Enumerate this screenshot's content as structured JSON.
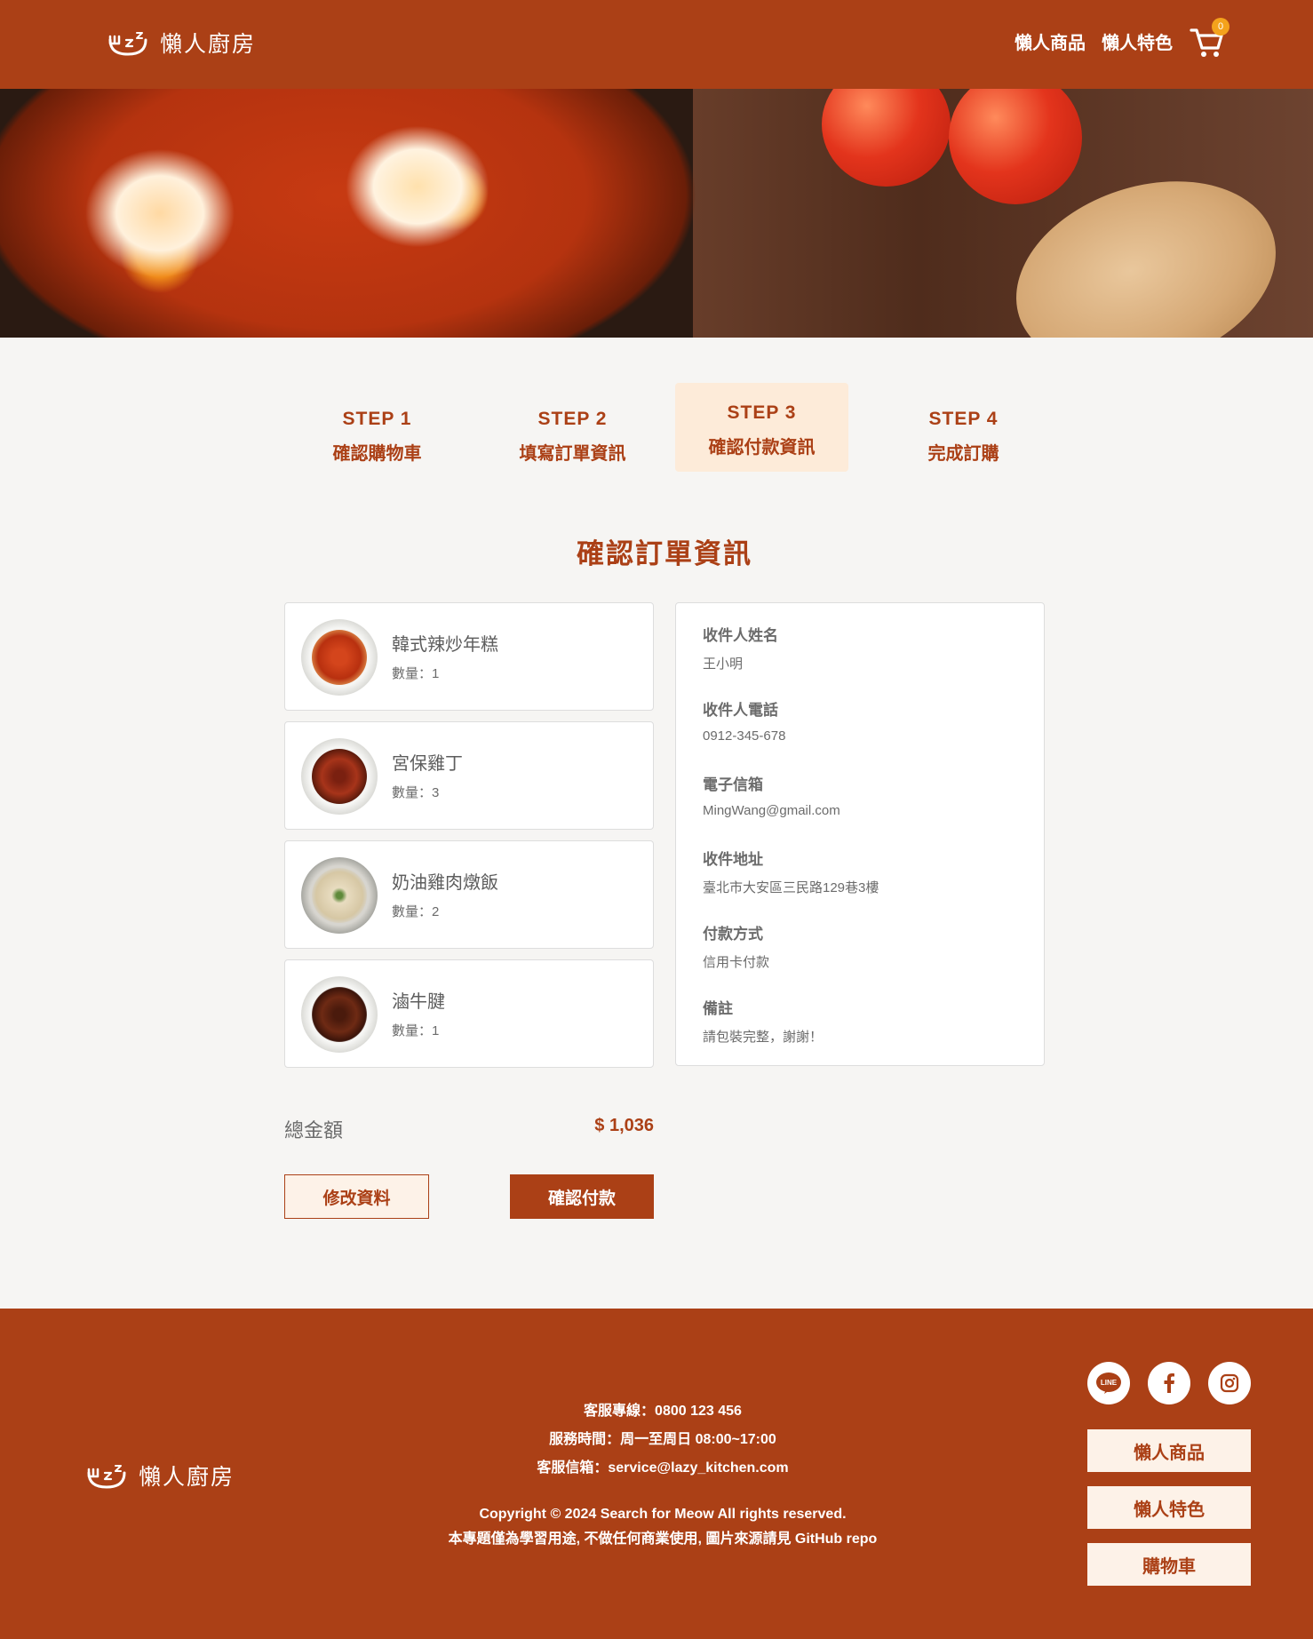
{
  "brand": {
    "name": "懶人廚房"
  },
  "nav": {
    "products": "懶人商品",
    "features": "懶人特色",
    "cart_count": "0"
  },
  "steps": [
    {
      "num": "STEP 1",
      "label": "確認購物車"
    },
    {
      "num": "STEP 2",
      "label": "填寫訂單資訊"
    },
    {
      "num": "STEP 3",
      "label": "確認付款資訊"
    },
    {
      "num": "STEP 4",
      "label": "完成訂購"
    }
  ],
  "page_title": "確認訂單資訊",
  "items": [
    {
      "name": "韓式辣炒年糕",
      "qty": "數量：1"
    },
    {
      "name": "宮保雞丁",
      "qty": "數量：3"
    },
    {
      "name": "奶油雞肉燉飯",
      "qty": "數量：2"
    },
    {
      "name": "滷牛腱",
      "qty": "數量：1"
    }
  ],
  "info": [
    {
      "label": "收件人姓名",
      "value": "王小明"
    },
    {
      "label": "收件人電話",
      "value": "0912-345-678"
    },
    {
      "label": "電子信箱",
      "value": "MingWang@gmail.com"
    },
    {
      "label": "收件地址",
      "value": "臺北市大安區三民路129巷3樓"
    },
    {
      "label": "付款方式",
      "value": "信用卡付款"
    },
    {
      "label": "備註",
      "value": "請包裝完整，謝謝！"
    }
  ],
  "total": {
    "label": "總金額",
    "value": "$ 1,036"
  },
  "buttons": {
    "edit": "修改資料",
    "pay": "確認付款"
  },
  "footer": {
    "phone": "客服專線：0800 123 456",
    "hours": "服務時間：周一至周日 08:00~17:00",
    "email": "客服信箱：service@lazy_kitchen.com",
    "copyright": "Copyright © 2024 Search for Meow All rights reserved.",
    "disclaimer": "本專題僅為學習用途, 不做任何商業使用, 圖片來源請見 GitHub repo",
    "links": [
      "懶人商品",
      "懶人特色",
      "購物車"
    ],
    "line_label": "LINE"
  },
  "colors": {
    "primary": "#ab4016",
    "accent": "#f4a21c",
    "step_active_bg": "#fdebd9"
  }
}
